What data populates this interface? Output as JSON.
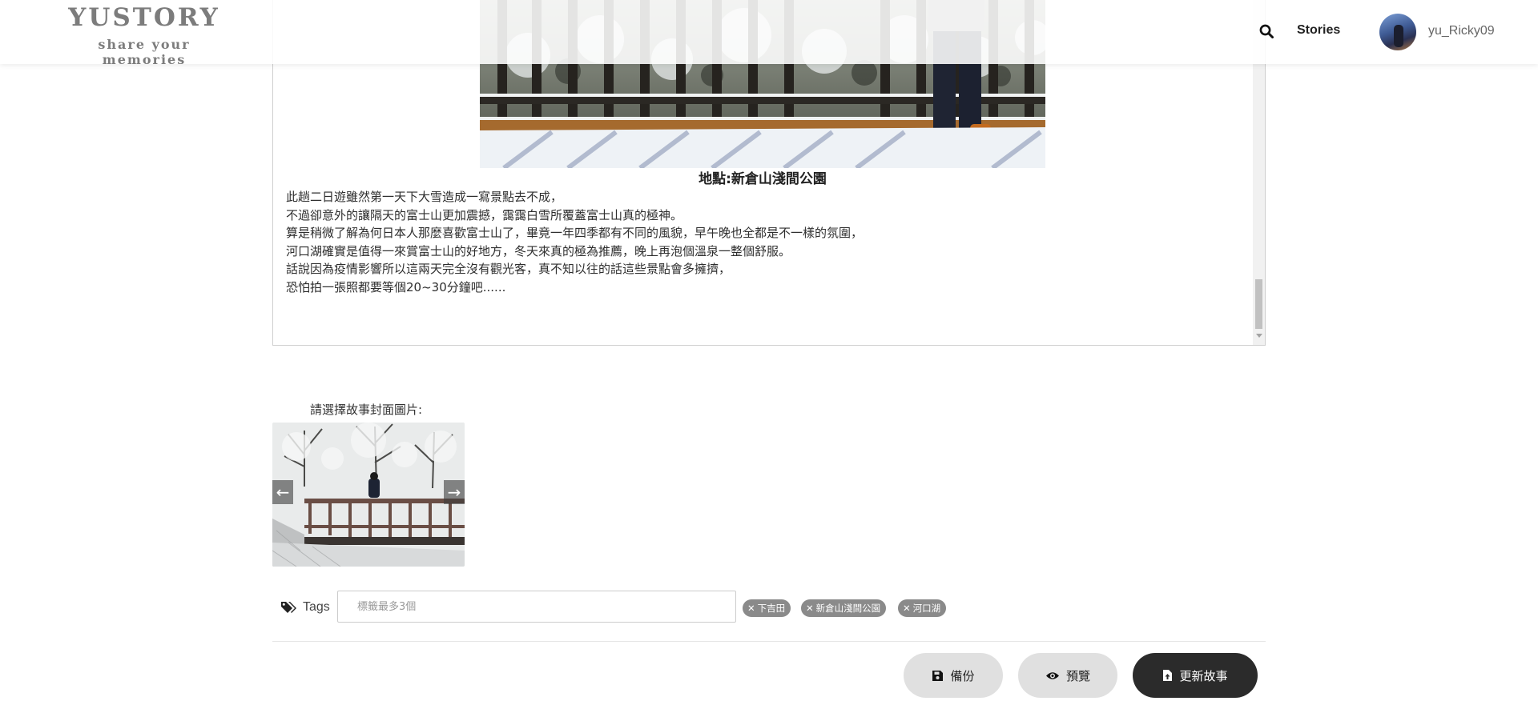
{
  "header": {
    "logo_title": "YUSTORY",
    "logo_subtitle": "share your memories",
    "search_icon": "search-icon",
    "nav_stories": "Stories",
    "username": "yu_Ricky09"
  },
  "editor": {
    "caption": "地點:新倉山淺間公園",
    "paragraphs": [
      "此趟二日遊雖然第一天下大雪造成一寫景點去不成，",
      "不過卻意外的讓隔天的富士山更加震撼，靄靄白雪所覆蓋富士山真的極神。",
      "",
      "算是稍微了解為何日本人那麼喜歡富士山了，畢竟一年四季都有不同的風貌，早午晚也全都是不一樣的氛圍，",
      "河口湖確實是值得一來賞富士山的好地方，冬天來真的極為推薦，晚上再泡個溫泉一整個舒服。",
      "",
      "話說因為疫情影響所以這兩天完全沒有觀光客，真不知以往的話這些景點會多擁擠，",
      "恐怕拍一張照都要等個20~30分鐘吧......"
    ]
  },
  "cover": {
    "label": "請選擇故事封面圖片:",
    "prev_icon": "chevron-left-icon",
    "next_icon": "chevron-right-icon"
  },
  "tags": {
    "label": "Tags",
    "placeholder": "標籤最多3個",
    "items": [
      "下吉田",
      "新倉山淺間公園",
      "河口湖"
    ]
  },
  "buttons": {
    "backup": "備份",
    "preview": "預覽",
    "update": "更新故事"
  }
}
